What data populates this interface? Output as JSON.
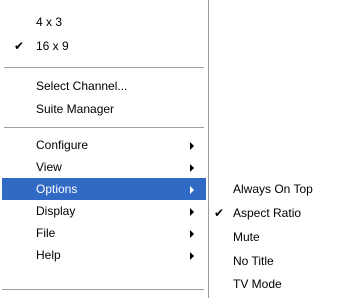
{
  "main_menu": {
    "items": [
      {
        "label": "4 x 3",
        "checked": false
      },
      {
        "label": "16 x 9",
        "checked": true
      },
      {
        "label": "Select Channel...",
        "checked": false
      },
      {
        "label": "Suite Manager",
        "checked": false
      },
      {
        "label": "Configure",
        "submenu": true
      },
      {
        "label": "View",
        "submenu": true
      },
      {
        "label": "Options",
        "submenu": true,
        "active": true
      },
      {
        "label": "Display",
        "submenu": true
      },
      {
        "label": "File",
        "submenu": true
      },
      {
        "label": "Help",
        "submenu": true
      }
    ]
  },
  "options_submenu": {
    "items": [
      {
        "label": "Always On Top",
        "checked": false
      },
      {
        "label": "Aspect Ratio",
        "checked": true
      },
      {
        "label": "Mute",
        "checked": false
      },
      {
        "label": "No Title",
        "checked": false
      },
      {
        "label": "TV Mode",
        "checked": false
      }
    ]
  },
  "glyphs": {
    "check": "✔"
  },
  "colors": {
    "highlight": "#316ac5",
    "highlight_text": "#ffffff"
  }
}
